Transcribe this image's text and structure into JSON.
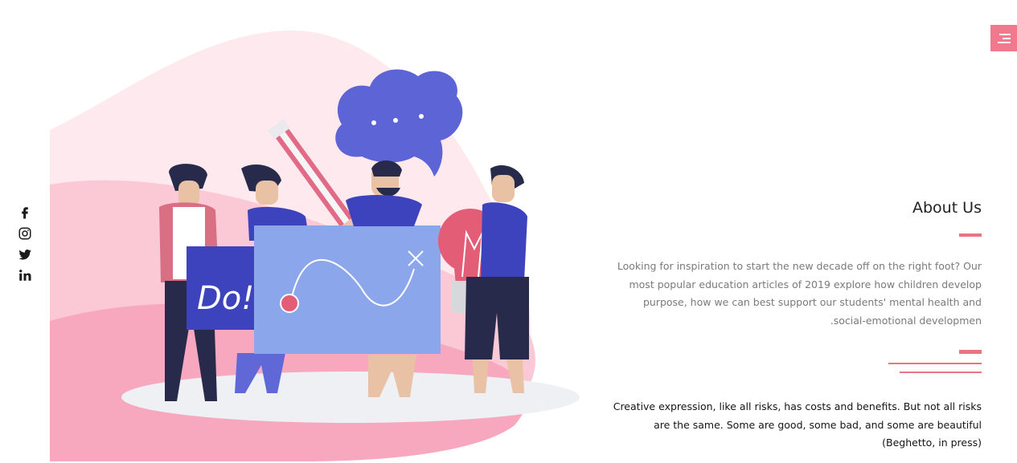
{
  "nav": {
    "menu_icon": "hamburger-menu-icon",
    "accent_color": "#f1798e"
  },
  "social": [
    {
      "name": "facebook-icon"
    },
    {
      "name": "instagram-icon"
    },
    {
      "name": "twitter-icon"
    },
    {
      "name": "linkedin-icon"
    }
  ],
  "illustration": {
    "do_sign_text": "Do!",
    "colors": {
      "pink": "#f7a8bf",
      "indigo": "#5d64d6",
      "light_blue": "#8ba6ea"
    }
  },
  "about": {
    "title": "About Us",
    "description": "Looking for inspiration to start the new decade off on the right foot? Our most popular education articles of 2019 explore how children develop purpose, how we can best support our students' mental health and social-emotional developmen.",
    "quote": "Creative expression, like all risks, has costs and benefits. But not all risks are the same. Some are good, some bad, and some are beautiful (Beghetto, in press)"
  }
}
